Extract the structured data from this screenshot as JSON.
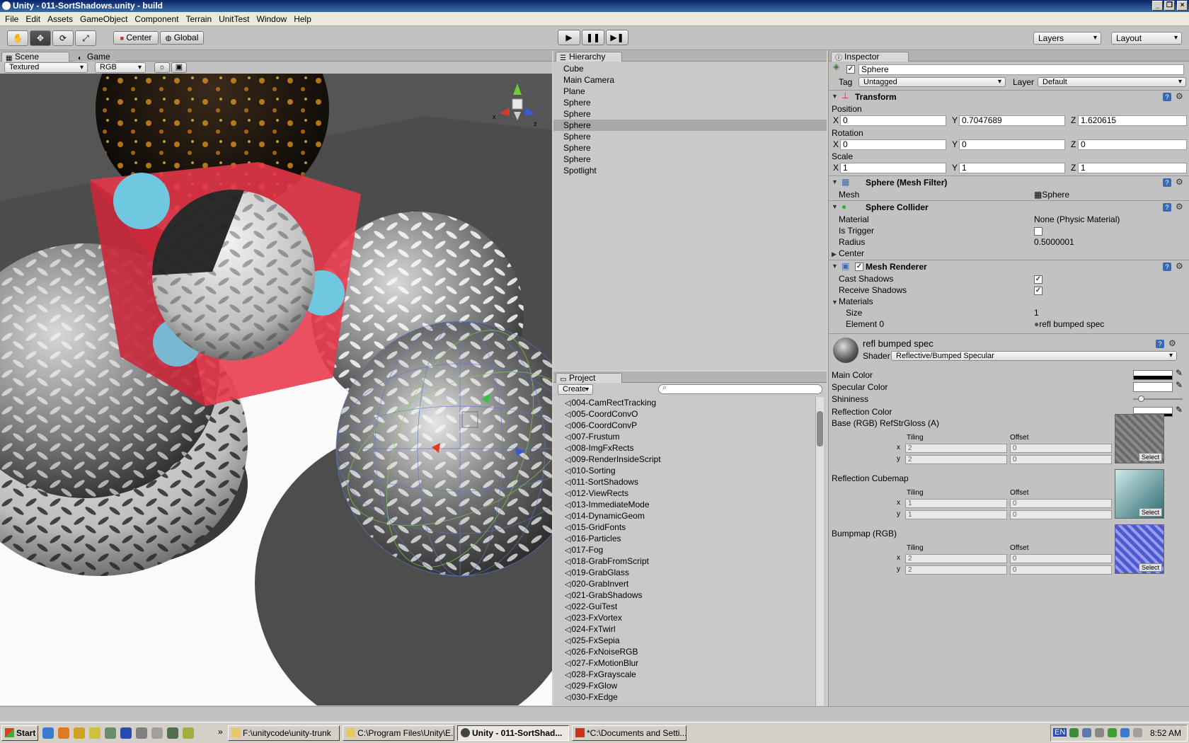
{
  "window": {
    "title": "Unity - 011-SortShadows.unity - build"
  },
  "menu": [
    "File",
    "Edit",
    "Assets",
    "GameObject",
    "Component",
    "Terrain",
    "UnitTest",
    "Window",
    "Help"
  ],
  "toolbar": {
    "pivot_label": "Center",
    "space_label": "Global",
    "layers_label": "Layers",
    "layout_label": "Layout",
    "tool_icons": [
      "hand-icon",
      "move-icon",
      "rotate-icon",
      "scale-icon"
    ],
    "play_icons": [
      "play-icon",
      "pause-icon",
      "step-icon"
    ]
  },
  "scene": {
    "tabs": [
      "Scene",
      "Game"
    ],
    "render_mode": "Textured",
    "color_mode": "RGB",
    "gizmo_axes": {
      "x": "x",
      "z": "z"
    }
  },
  "hierarchy": {
    "tab": "Hierarchy",
    "items": [
      "Cube",
      "Main Camera",
      "Plane",
      "Sphere",
      "Sphere",
      "Sphere",
      "Sphere",
      "Sphere",
      "Sphere",
      "Spotlight"
    ],
    "selected_index": 5
  },
  "project": {
    "tab": "Project",
    "create_label": "Create",
    "search_placeholder": "",
    "items": [
      "004-CamRectTracking",
      "005-CoordConvO",
      "006-CoordConvP",
      "007-Frustum",
      "008-ImgFxRects",
      "009-RenderInsideScript",
      "010-Sorting",
      "011-SortShadows",
      "012-ViewRects",
      "013-ImmediateMode",
      "014-DynamicGeom",
      "015-GridFonts",
      "016-Particles",
      "017-Fog",
      "018-GrabFromScript",
      "019-GrabGlass",
      "020-GrabInvert",
      "021-GrabShadows",
      "022-GuiTest",
      "023-FxVortex",
      "024-FxTwirl",
      "025-FxSepia",
      "026-FxNoiseRGB",
      "027-FxMotionBlur",
      "028-FxGrayscale",
      "029-FxGlow",
      "030-FxEdge"
    ]
  },
  "inspector": {
    "tab": "Inspector",
    "object_name": "Sphere",
    "tag_label": "Tag",
    "tag_value": "Untagged",
    "layer_label": "Layer",
    "layer_value": "Default",
    "transform": {
      "title": "Transform",
      "position_label": "Position",
      "position": {
        "x": "0",
        "y": "0.7047689",
        "z": "1.620615"
      },
      "rotation_label": "Rotation",
      "rotation": {
        "x": "0",
        "y": "0",
        "z": "0"
      },
      "scale_label": "Scale",
      "scale": {
        "x": "1",
        "y": "1",
        "z": "1"
      },
      "axis": {
        "x": "X",
        "y": "Y",
        "z": "Z"
      }
    },
    "mesh_filter": {
      "title": "Sphere (Mesh Filter)",
      "mesh_label": "Mesh",
      "mesh_value": "Sphere"
    },
    "collider": {
      "title": "Sphere Collider",
      "material_label": "Material",
      "material_value": "None (Physic Material)",
      "trigger_label": "Is Trigger",
      "is_trigger": false,
      "radius_label": "Radius",
      "radius_value": "0.5000001",
      "center_label": "Center"
    },
    "renderer": {
      "title": "Mesh Renderer",
      "cast_label": "Cast Shadows",
      "cast": true,
      "receive_label": "Receive Shadows",
      "receive": true,
      "materials_label": "Materials",
      "size_label": "Size",
      "size_value": "1",
      "element_label": "Element 0",
      "element_value": "refl bumped spec"
    },
    "material": {
      "name": "refl bumped spec",
      "shader_label": "Shader",
      "shader_value": "Reflective/Bumped Specular",
      "main_color": "Main Color",
      "spec_color": "Specular Color",
      "shininess": "Shininess",
      "shininess_level": 0.12,
      "refl_color": "Reflection Color",
      "tiling_label": "Tiling",
      "offset_label": "Offset",
      "x_label": "x",
      "y_label": "y",
      "select_label": "Select",
      "textures": [
        {
          "label": "Base (RGB) RefStrGloss (A)",
          "tiling_x": "2",
          "tiling_y": "2",
          "offset_x": "0",
          "offset_y": "0"
        },
        {
          "label": "Reflection Cubemap",
          "tiling_x": "1",
          "tiling_y": "1",
          "offset_x": "0",
          "offset_y": "0"
        },
        {
          "label": "Bumpmap (RGB)",
          "tiling_x": "2",
          "tiling_y": "2",
          "offset_x": "0",
          "offset_y": "0"
        }
      ]
    }
  },
  "taskbar": {
    "start_label": "Start",
    "tasks": [
      "F:\\unitycode\\unity-trunk",
      "C:\\Program Files\\Unity\\E...",
      "Unity - 011-SortShad...",
      "*C:\\Documents and Setti..."
    ],
    "active_index": 2,
    "clock": "8:52 AM",
    "lang": "EN"
  },
  "colors": {
    "title_bar": "#0a246a",
    "selection": "#a8a8a8",
    "cube_red": "#e8384a"
  }
}
